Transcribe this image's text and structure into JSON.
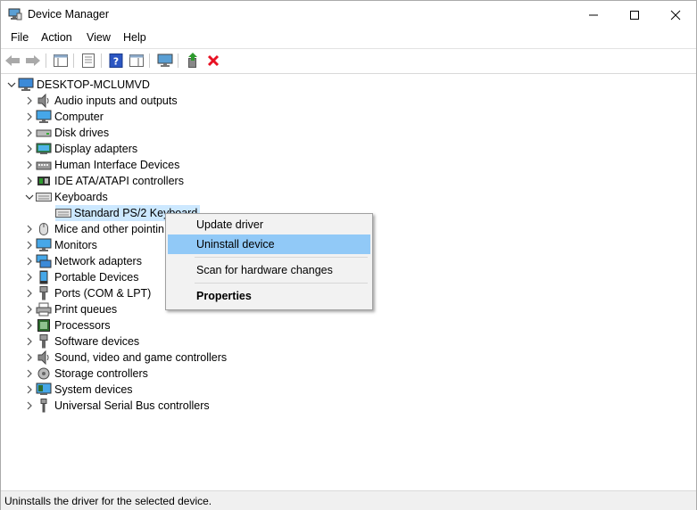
{
  "window": {
    "title": "Device Manager"
  },
  "menu": [
    "File",
    "Action",
    "View",
    "Help"
  ],
  "tree": {
    "root": "DESKTOP-MCLUMVD",
    "categories": [
      "Audio inputs and outputs",
      "Computer",
      "Disk drives",
      "Display adapters",
      "Human Interface Devices",
      "IDE ATA/ATAPI controllers",
      "Keyboards",
      "Mice and other pointin",
      "Monitors",
      "Network adapters",
      "Portable Devices",
      "Ports (COM & LPT)",
      "Print queues",
      "Processors",
      "Software devices",
      "Sound, video and game controllers",
      "Storage controllers",
      "System devices",
      "Universal Serial Bus controllers"
    ],
    "selected_device": "Standard PS/2 Keyboard"
  },
  "context_menu": {
    "update_driver": "Update driver",
    "uninstall_device": "Uninstall device",
    "scan_hardware": "Scan for hardware changes",
    "properties": "Properties"
  },
  "status": {
    "text": "Uninstalls the driver for the selected device."
  },
  "colors": {
    "selection": "#cce8ff",
    "menu_highlight": "#91c9f7",
    "delete_red": "#e81123"
  }
}
